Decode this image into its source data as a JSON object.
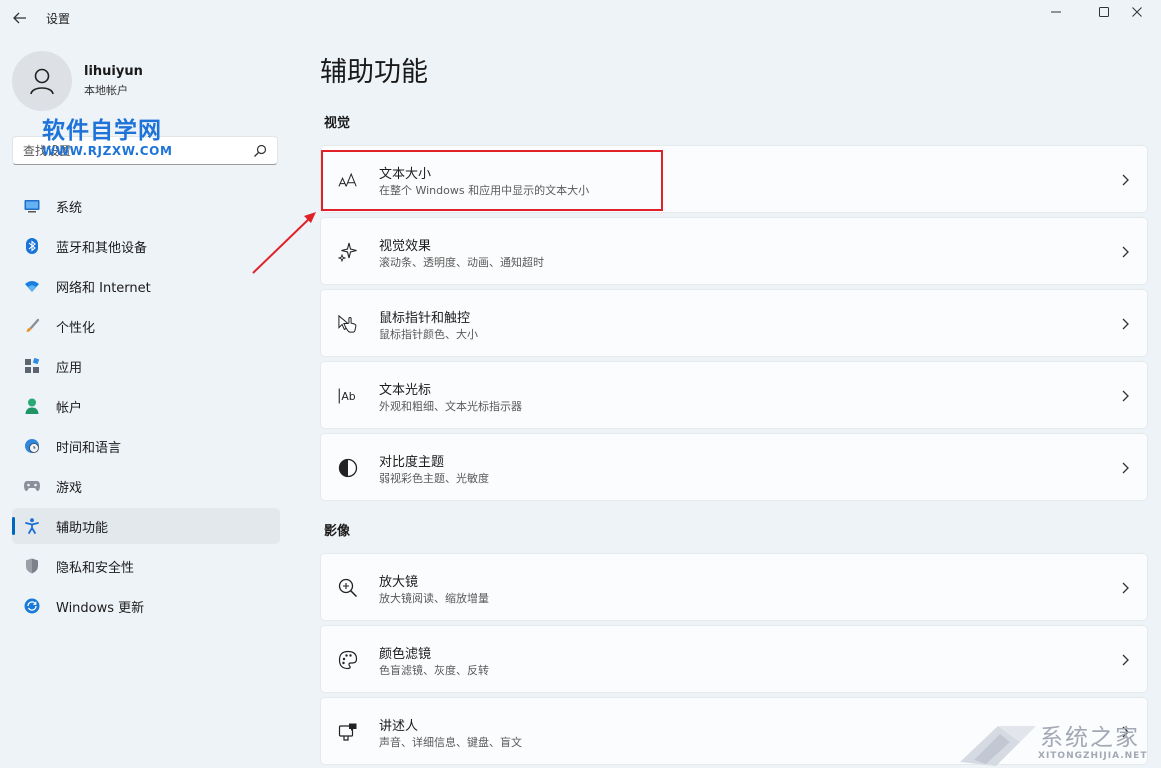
{
  "window": {
    "title": "设置",
    "controls": [
      "minimize-icon",
      "maximize-icon",
      "close-icon"
    ]
  },
  "profile": {
    "name": "lihuiyun",
    "account_type": "本地帐户"
  },
  "search": {
    "value": "",
    "placeholder": "查找设置"
  },
  "watermark": {
    "title": "软件自学网",
    "url": "WWW.RJZXW.COM"
  },
  "sidebar": {
    "items": [
      {
        "label": "系统",
        "icon": "monitor-icon"
      },
      {
        "label": "蓝牙和其他设备",
        "icon": "bluetooth-icon"
      },
      {
        "label": "网络和 Internet",
        "icon": "wifi-icon"
      },
      {
        "label": "个性化",
        "icon": "brush-icon"
      },
      {
        "label": "应用",
        "icon": "apps-icon"
      },
      {
        "label": "帐户",
        "icon": "person-icon"
      },
      {
        "label": "时间和语言",
        "icon": "globe-clock-icon"
      },
      {
        "label": "游戏",
        "icon": "gamepad-icon"
      },
      {
        "label": "辅助功能",
        "icon": "accessibility-icon",
        "selected": true
      },
      {
        "label": "隐私和安全性",
        "icon": "shield-icon"
      },
      {
        "label": "Windows 更新",
        "icon": "update-icon"
      }
    ]
  },
  "main": {
    "title": "辅助功能",
    "sections": [
      {
        "title": "视觉",
        "cards": [
          {
            "title": "文本大小",
            "subtitle": "在整个 Windows 和应用中显示的文本大小",
            "icon": "text-size-icon"
          },
          {
            "title": "视觉效果",
            "subtitle": "滚动条、透明度、动画、通知超时",
            "icon": "sparkle-icon"
          },
          {
            "title": "鼠标指针和触控",
            "subtitle": "鼠标指针颜色、大小",
            "icon": "pointer-touch-icon"
          },
          {
            "title": "文本光标",
            "subtitle": "外观和粗细、文本光标指示器",
            "icon": "text-cursor-icon"
          },
          {
            "title": "对比度主题",
            "subtitle": "弱视彩色主题、光敏度",
            "icon": "contrast-icon"
          }
        ]
      },
      {
        "title": "影像",
        "cards": [
          {
            "title": "放大镜",
            "subtitle": "放大镜阅读、缩放增量",
            "icon": "magnifier-icon"
          },
          {
            "title": "颜色滤镜",
            "subtitle": "色盲滤镜、灰度、反转",
            "icon": "palette-icon"
          },
          {
            "title": "讲述人",
            "subtitle": "声音、详细信息、键盘、盲文",
            "icon": "narrator-icon"
          }
        ]
      }
    ]
  },
  "text_cursor_glyph": "Ab",
  "corner_watermark": {
    "text": "系统之家",
    "url": "XITONGZHIJIA.NET"
  },
  "colors": {
    "accent": "#0067c0",
    "highlight_box": "#e02128",
    "background": "#eef3f8",
    "card": "#fbfcfd"
  }
}
